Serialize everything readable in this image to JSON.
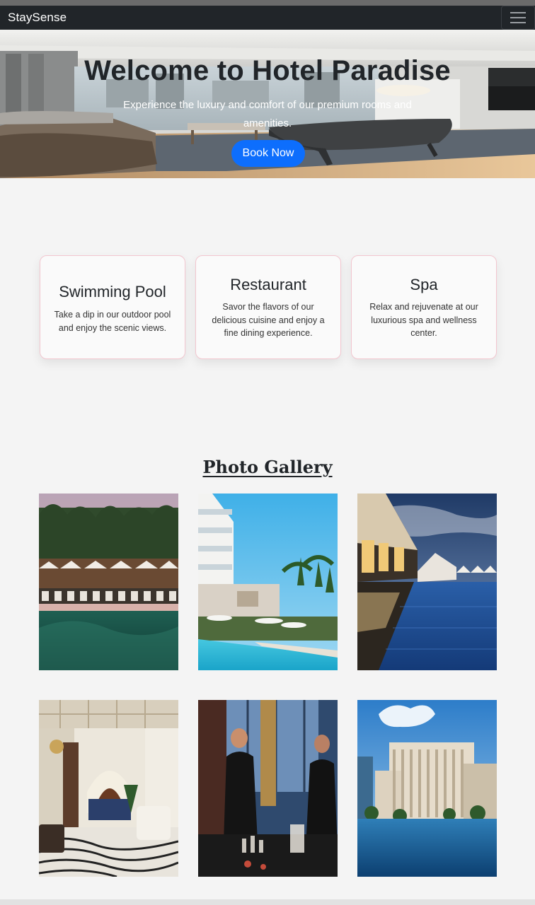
{
  "navbar": {
    "brand": "StaySense",
    "toggle_icon": "hamburger-menu-icon"
  },
  "hero": {
    "title": "Welcome to Hotel Paradise",
    "subtitle": "Experience the luxury and comfort of our premium rooms and amenities.",
    "cta_label": "Book Now"
  },
  "features": [
    {
      "title": "Swimming Pool",
      "text": "Take a dip in our outdoor pool and enjoy the scenic views."
    },
    {
      "title": "Restaurant",
      "text": "Savor the flavors of our delicious cuisine and enjoy a fine dining experience."
    },
    {
      "title": "Spa",
      "text": "Relax and rejuvenate at our luxurious spa and wellness center."
    }
  ],
  "gallery": {
    "title": "Photo Gallery",
    "photo_count": 6
  },
  "colors": {
    "navbar": "#212529",
    "primary": "#0d6efd",
    "page_bg": "#f4f4f4",
    "card_border": "#f2c6cf"
  }
}
